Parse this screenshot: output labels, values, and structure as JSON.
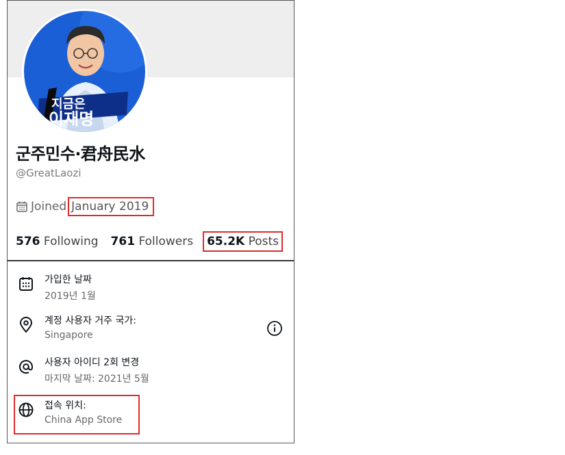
{
  "profile": {
    "name": "군주민수·君舟民水",
    "handle": "@GreatLaozi",
    "joined_prefix": "Joined",
    "joined_date": "January 2019",
    "avatar_text_line1": "지금은",
    "avatar_text_line2": "이재명"
  },
  "stats": {
    "following_count": "576",
    "following_label": "Following",
    "followers_count": "761",
    "followers_label": "Followers",
    "posts_count": "65.2K",
    "posts_label": "Posts"
  },
  "about": {
    "joined_title": "가입한 날짜",
    "joined_value": "2019년 1월",
    "country_title": "계정 사용자 거주 국가:",
    "country_value": "Singapore",
    "username_title": "사용자 아이디 2회 변경",
    "username_value": "마지막 날짜: 2021년 5월",
    "connected_title": "접속 위치:",
    "connected_value": "China App Store"
  },
  "colors": {
    "highlight": "#e02a2a",
    "avatar_background": "#1b5fd6",
    "banner": "#eeeeee"
  }
}
